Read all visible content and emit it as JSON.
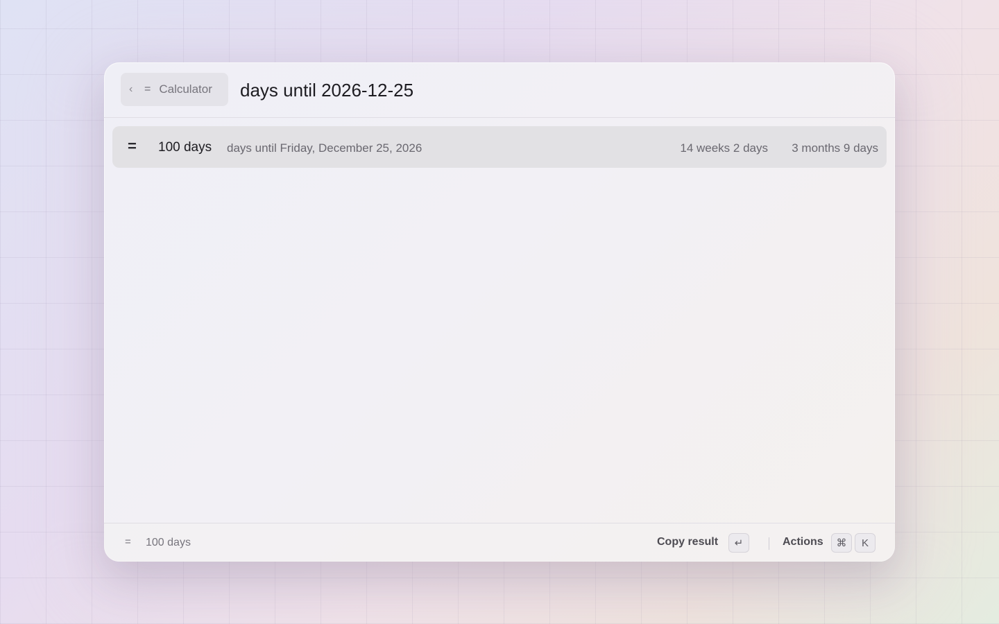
{
  "header": {
    "back_chip": {
      "chevron": "‹",
      "icon": "=",
      "label": "Calculator"
    },
    "query": "days until 2026-12-25"
  },
  "result": {
    "icon": "=",
    "value": "100 days",
    "description": "days until Friday, December 25, 2026",
    "alt_weeks": "14 weeks 2 days",
    "alt_months": "3 months 9 days"
  },
  "footer": {
    "icon": "=",
    "value": "100 days",
    "copy_label": "Copy result",
    "copy_key": "↵",
    "actions_label": "Actions",
    "actions_keys": [
      "⌘",
      "K"
    ]
  },
  "icons": {
    "back": "chevron-left-icon",
    "calculator": "equals-icon",
    "enter": "return-key-icon",
    "command": "command-key-icon"
  }
}
